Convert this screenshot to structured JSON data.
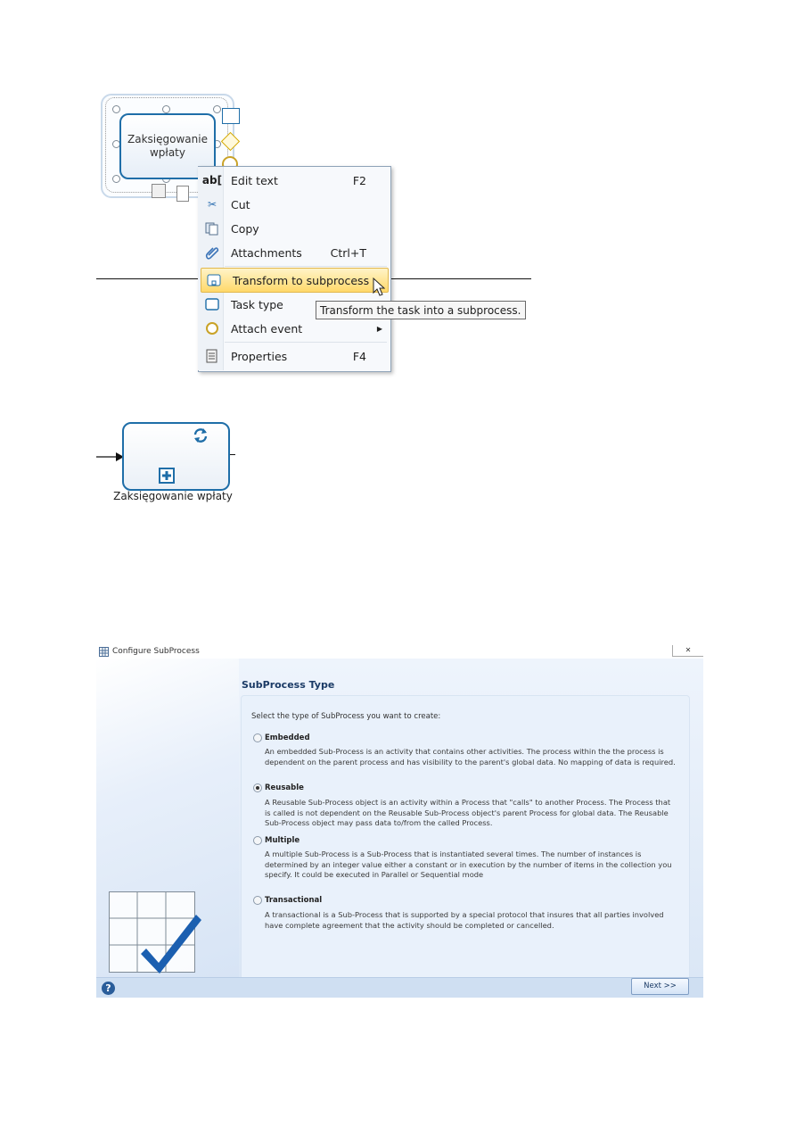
{
  "diagram_top": {
    "task_label": "Zaksięgowanie wpłaty",
    "context_menu": {
      "items": [
        {
          "icon": "ab-text-icon",
          "label": "Edit text",
          "shortcut": "F2"
        },
        {
          "icon": "scissors-icon",
          "label": "Cut",
          "shortcut": ""
        },
        {
          "icon": "copy-icon",
          "label": "Copy",
          "shortcut": ""
        },
        {
          "icon": "paperclip-icon",
          "label": "Attachments",
          "shortcut": "Ctrl+T"
        },
        {
          "icon": "subprocess-icon",
          "label": "Transform to subprocess",
          "shortcut": "",
          "highlighted": true
        },
        {
          "icon": "task-square-icon",
          "label": "Task type",
          "shortcut": ""
        },
        {
          "icon": "event-circle-icon",
          "label": "Attach event",
          "shortcut": "",
          "submenu_arrow": "▶"
        },
        {
          "icon": "properties-icon",
          "label": "Properties",
          "shortcut": "F4"
        }
      ],
      "tooltip": "Transform the task into a subprocess."
    }
  },
  "diagram_middle": {
    "subprocess_label": "Zaksięgowanie wpłaty"
  },
  "dialog": {
    "title": "Configure SubProcess",
    "close_label": "✕",
    "heading": "SubProcess Type",
    "prompt": "Select the type of SubProcess you want to create:",
    "options": [
      {
        "label": "Embedded",
        "selected": false,
        "description": "An embedded Sub-Process is an activity that contains other activities. The process within the the process is dependent on the parent process and has visibility to the parent's global data. No mapping of data is required."
      },
      {
        "label": "Reusable",
        "selected": true,
        "description": "A Reusable Sub-Process object is an activity within a Process that \"calls\" to another Process. The Process that is called is not dependent on the Reusable Sub-Process object's parent Process for global data. The Reusable Sub-Process object may pass data to/from the called Process."
      },
      {
        "label": "Multiple",
        "selected": false,
        "description": "A multiple Sub-Process is a Sub-Process that is instantiated several times. The number of instances is determined by an integer value either a constant or in execution by the number of items in the collection you specify.  It could be executed in Parallel or Sequential mode"
      },
      {
        "label": "Transactional",
        "selected": false,
        "description": "A transactional is a Sub-Process that is supported by a special protocol that insures that all parties involved have complete agreement that the activity should be completed or cancelled."
      }
    ],
    "help_label": "?",
    "next_label": "Next >>"
  },
  "colors": {
    "task_border": "#1f6ea8",
    "highlight": "#ffd86a",
    "dialog_bg": "#dbe7f6",
    "check_blue": "#1b5fb0"
  }
}
